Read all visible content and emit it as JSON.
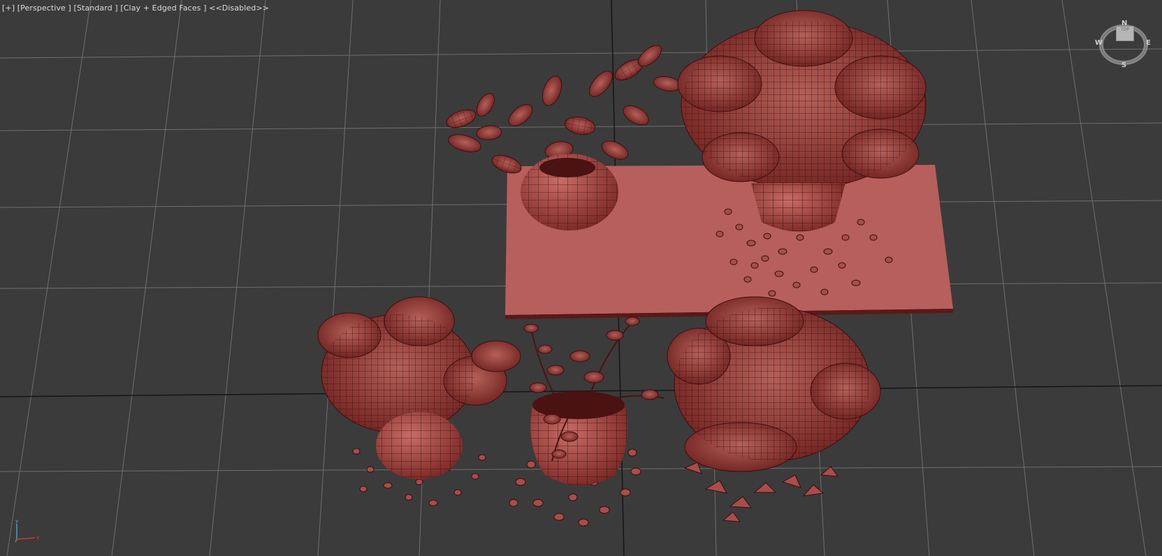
{
  "viewport": {
    "label_parts": [
      "[+]",
      "[Perspective ]",
      "[Standard ]",
      "[Clay + Edged Faces ]",
      "<<Disabled>>"
    ],
    "background": "#3b3b3b",
    "grid_color": "#8c8c8c",
    "clay_color": "#b9605c",
    "wire_color": "#3e0e0e"
  },
  "viewcube": {
    "north": "N",
    "south": "S",
    "east": "E",
    "west": "W",
    "face": "TOP"
  },
  "axis_tripod": {
    "x_label": "x",
    "y_label": "y",
    "z_label": "z"
  }
}
